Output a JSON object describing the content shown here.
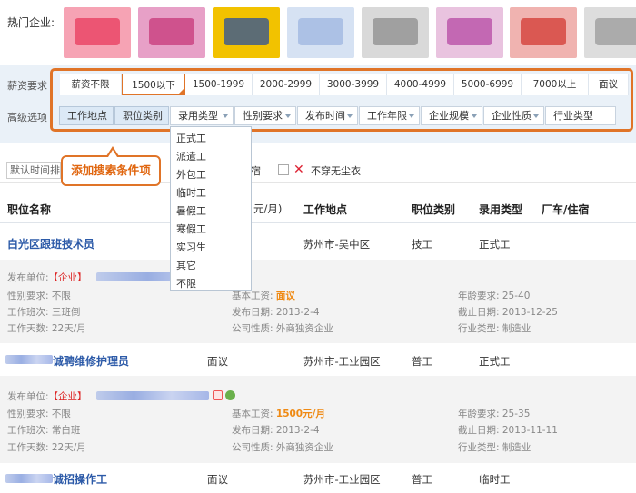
{
  "hot": {
    "label": "热门企业:",
    "logos": [
      {
        "name": "company-logo-1",
        "colors": [
          "#e83b5d",
          "#f6a3b4"
        ]
      },
      {
        "name": "company-logo-2",
        "colors": [
          "#c7387a",
          "#e7a0c7"
        ]
      },
      {
        "name": "company-logo-3",
        "colors": [
          "#2a4f9c",
          "#f2c200"
        ]
      },
      {
        "name": "company-logo-4",
        "colors": [
          "#9db6e0",
          "#d6e2f3"
        ]
      },
      {
        "name": "company-logo-5",
        "colors": [
          "#8c8c8c",
          "#d9d9d9"
        ]
      },
      {
        "name": "company-logo-6",
        "colors": [
          "#b64aa4",
          "#e9c3df"
        ]
      },
      {
        "name": "company-logo-7",
        "colors": [
          "#d33a33",
          "#f0b3b0"
        ]
      },
      {
        "name": "company-logo-8",
        "colors": [
          "#999999",
          "#dddddd"
        ]
      },
      {
        "name": "company-logo-9",
        "colors": [
          "#e94b3c",
          "#f6c1bc"
        ]
      }
    ]
  },
  "salary": {
    "label": "薪资要求",
    "options": [
      "薪资不限",
      "1500以下",
      "1500-1999",
      "2000-2999",
      "3000-3999",
      "4000-4999",
      "5000-6999",
      "7000以上",
      "面议"
    ]
  },
  "advanced": {
    "label": "高级选项",
    "options": [
      "工作地点",
      "职位类别",
      "录用类型",
      "性别要求",
      "发布时间",
      "工作年限",
      "企业规模",
      "企业性质",
      "行业类型"
    ]
  },
  "dropdown": {
    "items": [
      "正式工",
      "派遣工",
      "外包工",
      "临时工",
      "暑假工",
      "寒假工",
      "实习生",
      "其它",
      "不限"
    ]
  },
  "callout": {
    "text": "添加搜索条件项"
  },
  "sortbar": {
    "select_value": "默认时间排序",
    "partial_text": "宿",
    "option_label": "不穿无尘衣"
  },
  "table": {
    "headers": [
      "职位名称",
      "元/月)",
      "工作地点",
      "职位类别",
      "录用类型",
      "厂车/住宿"
    ]
  },
  "jobs": [
    {
      "title": "白光区跟班技术员",
      "salary": "",
      "location": "苏州市-吴中区",
      "category": "技工",
      "type": "正式工",
      "publisher_label": "发布单位:",
      "publisher_tag": "【企业】",
      "gender": "性别要求: 不限",
      "shift": "工作班次: 三班倒",
      "days": "工作天数: 22天/月",
      "base_label": "基本工资:",
      "base_value": "面议",
      "date": "发布日期: 2013-2-4",
      "nature": "公司性质: 外商独资企业",
      "age": "年龄要求: 25-40",
      "deadline": "截止日期: 2013-12-25",
      "industry": "行业类型: 制造业"
    },
    {
      "title": "诚聘维修护理员",
      "salary": "面议",
      "location": "苏州市-工业园区",
      "category": "普工",
      "type": "正式工",
      "publisher_label": "发布单位:",
      "publisher_tag": "【企业】",
      "gender": "性别要求: 不限",
      "shift": "工作班次: 常白班",
      "days": "工作天数: 22天/月",
      "base_label": "基本工资:",
      "base_value": "1500元/月",
      "date": "发布日期: 2013-2-4",
      "nature": "公司性质: 外商独资企业",
      "age": "年龄要求: 25-35",
      "deadline": "截止日期: 2013-11-11",
      "industry": "行业类型: 制造业"
    },
    {
      "title": "诚招操作工",
      "salary": "面议",
      "location": "苏州市-工业园区",
      "category": "普工",
      "type": "临时工"
    }
  ],
  "colors": {
    "accent": "#e07428",
    "link": "#2c5aa8",
    "panel": "#eaf1f8",
    "salary_highlight": "#ef8a14",
    "tag_red": "#d22222"
  }
}
